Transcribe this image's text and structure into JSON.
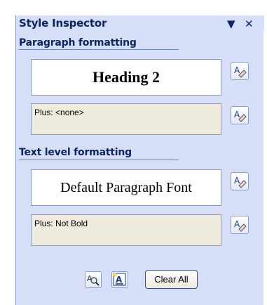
{
  "pane": {
    "title": "Style Inspector",
    "menu_icon": "dropdown-arrow-icon",
    "close_icon": "close-icon"
  },
  "paragraph_section": {
    "title": "Paragraph formatting",
    "style_name": "Heading 2",
    "plus_text": "Plus: <none>",
    "reveal_icon": "clear-formatting-icon"
  },
  "text_section": {
    "title": "Text level formatting",
    "style_name": "Default Paragraph Font",
    "plus_text": "Plus: Not Bold",
    "reveal_icon": "clear-formatting-icon"
  },
  "footer": {
    "reveal_formatting_icon": "magnifier-icon",
    "new_style_icon": "new-style-icon",
    "clear_all_label": "Clear All"
  },
  "colors": {
    "pane_bg": "#D6DFF7",
    "title_text": "#0D2563",
    "plus_box_bg": "#EFEBDE"
  }
}
